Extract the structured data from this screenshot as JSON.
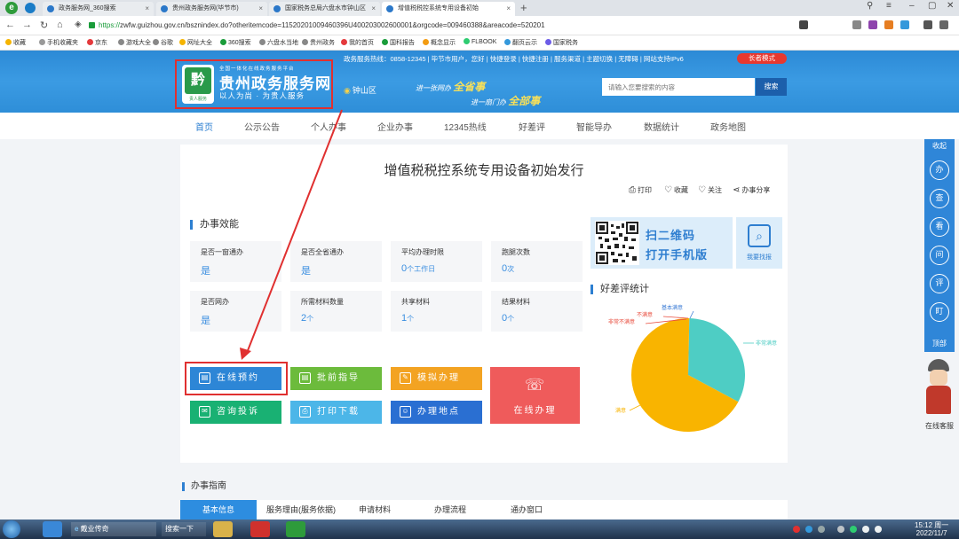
{
  "browser": {
    "logo": "e",
    "tabs": [
      {
        "label": "政务服务网_360搜索"
      },
      {
        "label": "贵州政务服务网(毕节市)"
      },
      {
        "label": "国家税务总局六盘水市钟山区"
      },
      {
        "label": "增值税税控系统专用设备初始"
      }
    ],
    "new_tab": "+",
    "url_scheme": "https://",
    "url_rest": "zwfw.guizhou.gov.cn/bsznindex.do?otheritemcode=11520201009460396U400203002600001&orgcode=009460388&areacode=520201",
    "bookmarks": [
      "收藏",
      "手机收藏夹",
      "京东",
      "游戏大全",
      "谷歌",
      "网址大全",
      "360搜索",
      "六盘水当地",
      "贵州政务",
      "我的首页",
      "国科报告",
      "概念显示",
      "FLBOOK",
      "翻页云示",
      "国家税务"
    ]
  },
  "header": {
    "topline": "政务服务热线：0858-12345  |  毕节市用户，您好  |  快捷登录  |  快捷注册  |  服务渠道  |  主题切换  |  无障碍  |  网站支持IPv6",
    "elder_mode": "长者模式",
    "logo_glyph": "黔",
    "logo_sub": "贵人服务",
    "logo_small": "全国一体化在线政务服务平台",
    "site_title": "贵州政务服务网",
    "slogan": "以人为尚 · 为贵人服务",
    "region": "钟山区",
    "motto1_pre": "进一张网办",
    "motto1_em": "全省事",
    "motto2_pre": "进一扇门办",
    "motto2_em": "全部事",
    "search_placeholder": "请输入您要搜索的内容",
    "search_button": "搜索"
  },
  "nav": [
    "首页",
    "公示公告",
    "个人办事",
    "企业办事",
    "12345热线",
    "好差评",
    "智能导办",
    "数据统计",
    "政务地图"
  ],
  "page": {
    "title": "增值税税控系统专用设备初始发行",
    "actions": [
      {
        "label": "打印",
        "icon": "printer-icon"
      },
      {
        "label": "收藏",
        "icon": "heart-icon"
      },
      {
        "label": "关注",
        "icon": "heart-outline-icon"
      },
      {
        "label": "办事分享",
        "icon": "share-icon"
      }
    ],
    "efficiency_title": "办事效能",
    "efficiency": [
      {
        "label": "是否一窗通办",
        "value": "是",
        "unit": ""
      },
      {
        "label": "是否全省通办",
        "value": "是",
        "unit": ""
      },
      {
        "label": "平均办理时限",
        "value": "0",
        "unit": "个工作日"
      },
      {
        "label": "跑腿次数",
        "value": "0",
        "unit": "次"
      },
      {
        "label": "是否网办",
        "value": "是",
        "unit": ""
      },
      {
        "label": "所需材料数量",
        "value": "2",
        "unit": "个"
      },
      {
        "label": "共享材料",
        "value": "1",
        "unit": "个"
      },
      {
        "label": "结果材料",
        "value": "0",
        "unit": "个"
      }
    ],
    "qr_line1": "扫二维码",
    "qr_line2": "打开手机版",
    "ask_label": "我要找报",
    "services": [
      {
        "label": "在线预约",
        "color": "#2d86d6"
      },
      {
        "label": "批前指导",
        "color": "#6cbb3c"
      },
      {
        "label": "模拟办理",
        "color": "#f3a322"
      },
      {
        "label": "咨询投诉",
        "color": "#19b173"
      },
      {
        "label": "打印下载",
        "color": "#4cb6e8"
      },
      {
        "label": "办理地点",
        "color": "#2a6fd2"
      }
    ],
    "online_handle": "在线办理",
    "rating_title": "好差评统计",
    "pie_labels": [
      "基本满意",
      "不满意",
      "非常不满意",
      "非常满意",
      "满意"
    ]
  },
  "chart_data": {
    "type": "pie",
    "title": "好差评统计",
    "categories": [
      "非常满意",
      "满意",
      "基本满意",
      "不满意",
      "非常不满意"
    ],
    "values": [
      32.5,
      67.5,
      0,
      0,
      0
    ],
    "colors": [
      "#4ecdc4",
      "#f9b400",
      "#3a7bd5",
      "#e84c3d",
      "#9b59b6"
    ],
    "legend": "none"
  },
  "guide": {
    "title": "办事指南",
    "tabs": [
      "基本信息",
      "服务理由(服务依据)",
      "申请材料",
      "办理流程",
      "通办窗口"
    ]
  },
  "sidebar": {
    "collapse": "收起",
    "buttons": [
      "办",
      "查",
      "看",
      "问",
      "评",
      "盯"
    ],
    "top": "顶部",
    "service": "在线客服"
  },
  "taskbar": {
    "items": [
      "戴业传奇",
      "搜索一下"
    ],
    "time": "15:12 周一",
    "date": "2022/11/7"
  }
}
